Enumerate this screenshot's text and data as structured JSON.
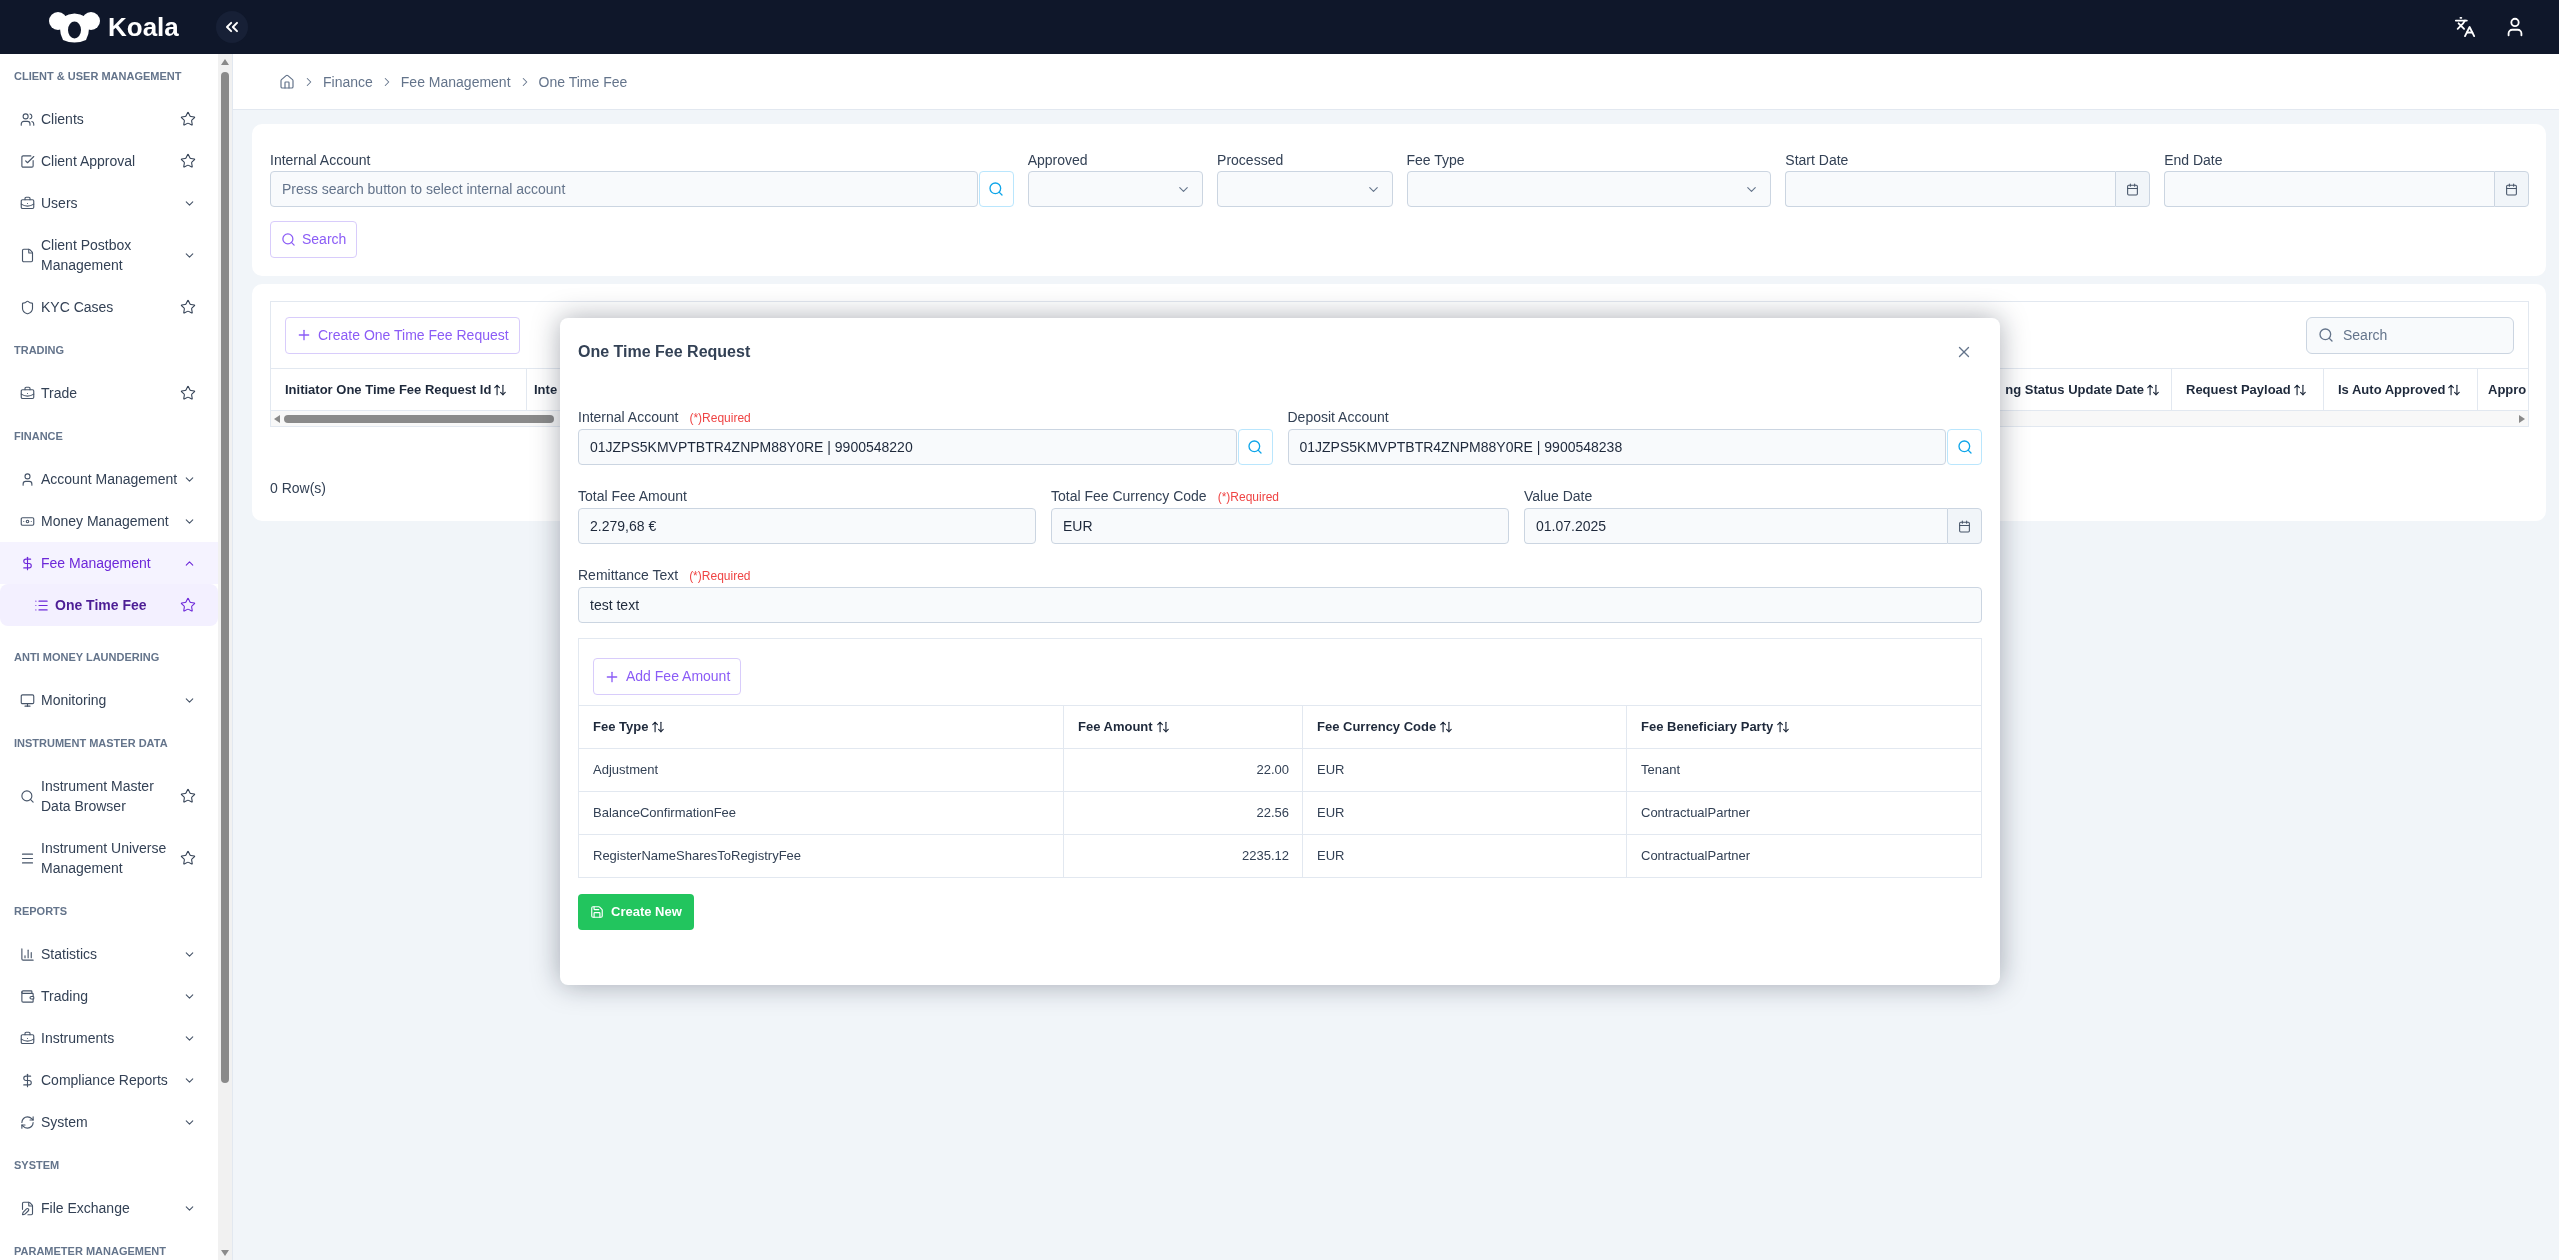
{
  "topbar": {
    "logo_text": "Koala"
  },
  "sidebar": {
    "sections": [
      {
        "title": "CLIENT & USER MANAGEMENT",
        "items": [
          {
            "label": "Clients",
            "kind": "link",
            "selected": false
          },
          {
            "label": "Client Approval",
            "kind": "link",
            "selected": false
          },
          {
            "label": "Users",
            "kind": "group",
            "expanded": false,
            "selected": false
          },
          {
            "label": "Client Postbox Management",
            "kind": "group",
            "expanded": false,
            "selected": false
          },
          {
            "label": "KYC Cases",
            "kind": "link",
            "selected": false
          }
        ]
      },
      {
        "title": "TRADING",
        "items": [
          {
            "label": "Trade",
            "kind": "link",
            "selected": false
          }
        ]
      },
      {
        "title": "FINANCE",
        "items": [
          {
            "label": "Account Management",
            "kind": "group",
            "expanded": false,
            "selected": false
          },
          {
            "label": "Money Management",
            "kind": "group",
            "expanded": false,
            "selected": false
          },
          {
            "label": "Fee Management",
            "kind": "group",
            "expanded": true,
            "selected": true,
            "children": [
              {
                "label": "One Time Fee",
                "kind": "link",
                "selected": true
              }
            ]
          }
        ]
      },
      {
        "title": "ANTI MONEY LAUNDERING",
        "items": [
          {
            "label": "Monitoring",
            "kind": "group",
            "expanded": false,
            "selected": false
          }
        ]
      },
      {
        "title": "INSTRUMENT MASTER DATA",
        "items": [
          {
            "label": "Instrument Master Data Browser",
            "kind": "link",
            "selected": false
          },
          {
            "label": "Instrument Universe Management",
            "kind": "link",
            "selected": false
          }
        ]
      },
      {
        "title": "REPORTS",
        "items": [
          {
            "label": "Statistics",
            "kind": "group",
            "expanded": false,
            "selected": false
          },
          {
            "label": "Trading",
            "kind": "group",
            "expanded": false,
            "selected": false
          },
          {
            "label": "Instruments",
            "kind": "group",
            "expanded": false,
            "selected": false
          },
          {
            "label": "Compliance Reports",
            "kind": "group",
            "expanded": false,
            "selected": false
          },
          {
            "label": "System",
            "kind": "group",
            "expanded": false,
            "selected": false
          }
        ]
      },
      {
        "title": "SYSTEM",
        "items": [
          {
            "label": "File Exchange",
            "kind": "group",
            "expanded": false,
            "selected": false
          }
        ]
      },
      {
        "title": "PARAMETER MANAGEMENT"
      }
    ]
  },
  "breadcrumb": [
    {
      "label": "Finance"
    },
    {
      "label": "Fee Management"
    },
    {
      "label": "One Time Fee"
    }
  ],
  "filters": {
    "fields": [
      {
        "label": "Internal Account",
        "kind": "lookup",
        "placeholder": "Press search button to select internal account"
      },
      {
        "label": "Approved",
        "kind": "select"
      },
      {
        "label": "Processed",
        "kind": "select"
      },
      {
        "label": "Fee Type",
        "kind": "select"
      },
      {
        "label": "Start Date",
        "kind": "date"
      },
      {
        "label": "End Date",
        "kind": "date"
      }
    ],
    "search_button": "Search"
  },
  "table": {
    "create_button": "Create One Time Fee Request",
    "search": {
      "placeholder": "Search"
    },
    "columns": [
      {
        "label": "Initiator One Time Fee Request Id",
        "sortable": true
      },
      {
        "label": "Inte",
        "sortable": false
      },
      {
        "label": "ng Status Update Date",
        "sortable": true
      },
      {
        "label": "Request Payload",
        "sortable": true
      },
      {
        "label": "Is Auto Approved",
        "sortable": true
      },
      {
        "label": "Appro",
        "sortable": false
      }
    ],
    "row_count": "0 Row(s)"
  },
  "modal": {
    "title": "One Time Fee Request",
    "rows": [
      {
        "fields": [
          {
            "label": "Internal Account",
            "required_note": "(*)Required",
            "kind": "lookup",
            "value": "01JZPS5KMVPTBTR4ZNPM88Y0RE | 9900548220"
          },
          {
            "label": "Deposit Account",
            "kind": "lookup",
            "value": "01JZPS5KMVPTBTR4ZNPM88Y0RE | 9900548238"
          }
        ]
      },
      {
        "fields": [
          {
            "label": "Total Fee Amount",
            "kind": "text",
            "value": "2.279,68 €"
          },
          {
            "label": "Total Fee Currency Code",
            "required_note": "(*)Required",
            "kind": "text",
            "value": "EUR"
          },
          {
            "label": "Value Date",
            "kind": "date",
            "value": "01.07.2025"
          }
        ]
      },
      {
        "fields": [
          {
            "label": "Remittance Text",
            "required_note": "(*)Required",
            "kind": "text",
            "value": "test text"
          }
        ]
      }
    ],
    "fee_table": {
      "add_button": "Add Fee Amount",
      "columns": [
        {
          "label": "Fee Type",
          "kind": "text",
          "sortable": true
        },
        {
          "label": "Fee Amount",
          "kind": "number",
          "sortable": true
        },
        {
          "label": "Fee Currency Code",
          "kind": "text",
          "sortable": true
        },
        {
          "label": "Fee Beneficiary Party",
          "kind": "text",
          "sortable": true
        }
      ],
      "rows": [
        [
          "Adjustment",
          "22.00",
          "EUR",
          "Tenant"
        ],
        [
          "BalanceConfirmationFee",
          "22.56",
          "EUR",
          "ContractualPartner"
        ],
        [
          "RegisterNameSharesToRegistryFee",
          "2235.12",
          "EUR",
          "ContractualPartner"
        ]
      ]
    },
    "submit_button": "Create New"
  }
}
